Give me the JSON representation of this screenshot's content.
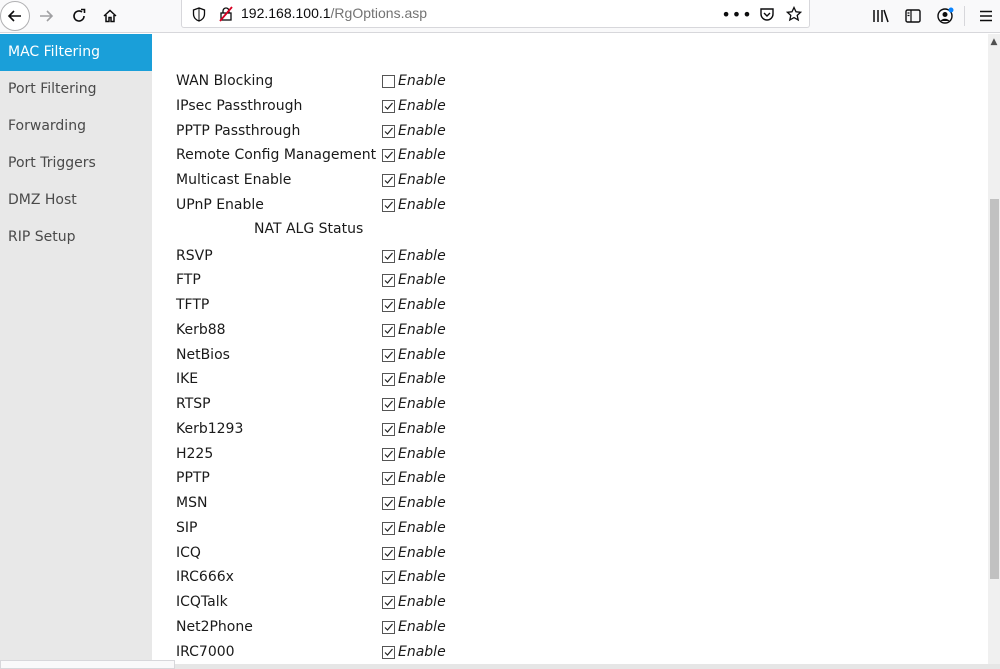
{
  "browser": {
    "url_host": "192.168.100.1",
    "url_path": "/RgOptions.asp"
  },
  "sidebar": {
    "items": [
      {
        "label": "MAC Filtering",
        "active": true
      },
      {
        "label": "Port Filtering",
        "active": false
      },
      {
        "label": "Forwarding",
        "active": false
      },
      {
        "label": "Port Triggers",
        "active": false
      },
      {
        "label": "DMZ Host",
        "active": false
      },
      {
        "label": "RIP Setup",
        "active": false
      }
    ]
  },
  "options": {
    "enable_label": "Enable",
    "general": [
      {
        "label": "WAN Blocking",
        "checked": false
      },
      {
        "label": "IPsec Passthrough",
        "checked": true
      },
      {
        "label": "PPTP Passthrough",
        "checked": true
      },
      {
        "label": "Remote Config Management",
        "checked": true
      },
      {
        "label": "Multicast Enable",
        "checked": true
      },
      {
        "label": "UPnP Enable",
        "checked": true
      }
    ],
    "nat_alg_title": "NAT ALG Status",
    "nat_alg": [
      {
        "label": "RSVP",
        "checked": true
      },
      {
        "label": "FTP",
        "checked": true
      },
      {
        "label": "TFTP",
        "checked": true
      },
      {
        "label": "Kerb88",
        "checked": true
      },
      {
        "label": "NetBios",
        "checked": true
      },
      {
        "label": "IKE",
        "checked": true
      },
      {
        "label": "RTSP",
        "checked": true
      },
      {
        "label": "Kerb1293",
        "checked": true
      },
      {
        "label": "H225",
        "checked": true
      },
      {
        "label": "PPTP",
        "checked": true
      },
      {
        "label": "MSN",
        "checked": true
      },
      {
        "label": "SIP",
        "checked": true
      },
      {
        "label": "ICQ",
        "checked": true
      },
      {
        "label": "IRC666x",
        "checked": true
      },
      {
        "label": "ICQTalk",
        "checked": true
      },
      {
        "label": "Net2Phone",
        "checked": true
      },
      {
        "label": "IRC7000",
        "checked": true
      }
    ]
  },
  "colors": {
    "sidebar_active": "#1a9fd9",
    "sidebar_bg": "#e8e8e8"
  }
}
